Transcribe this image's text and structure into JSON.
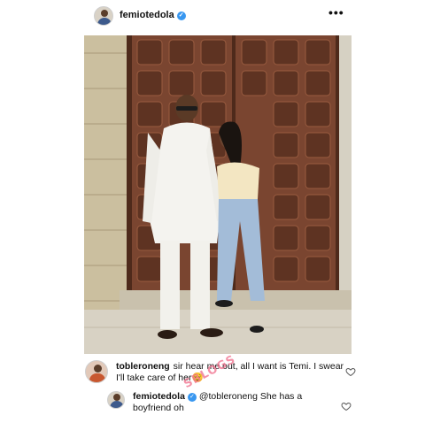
{
  "post": {
    "username": "femiotedola",
    "verified_icon": "verified-badge-icon",
    "more_icon": "more-options-icon"
  },
  "photo": {
    "description_colors": {
      "wall": "#c8bda8",
      "door": "#6b3a25",
      "shirt": "#f5f4f1",
      "jeans": "#9fb8d6"
    }
  },
  "comments": [
    {
      "username": "tobleroneng",
      "text": "sir hear me out, all I want is Temi. I swear I'll take care of her😌"
    }
  ],
  "reply": {
    "username": "femiotedola",
    "mention": "@tobleroneng",
    "text": "She has a boyfriend oh"
  },
  "watermark": "SBLOGS",
  "colors": {
    "verified": "#3897f0",
    "watermark": "#f06d8a"
  }
}
